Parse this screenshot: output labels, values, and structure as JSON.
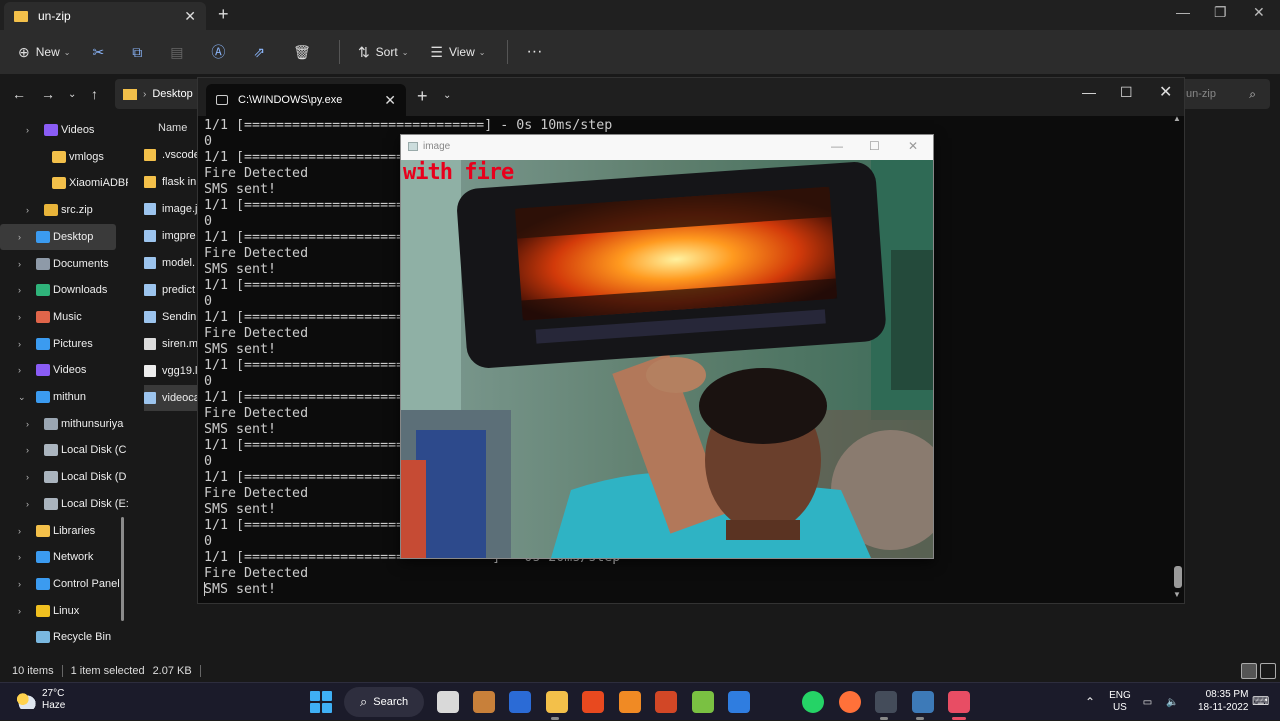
{
  "explorer": {
    "tab_title": "un-zip",
    "new_tab": "+",
    "close": "✕",
    "toolbar": {
      "new_label": "New",
      "sort_label": "Sort",
      "view_label": "View",
      "more": "···"
    },
    "address_crumb": "Desktop",
    "search_placeholder": "un-zip",
    "column_header": "Name",
    "nav": [
      {
        "label": "Videos",
        "color": "#8a5cf5",
        "chev": ">"
      },
      {
        "label": "vmlogs",
        "color": "#f3c04a",
        "chev": ""
      },
      {
        "label": "XiaomiADBFa",
        "color": "#f3c04a",
        "chev": ""
      },
      {
        "label": "src.zip",
        "color": "#e8b43a",
        "chev": ">"
      },
      {
        "label": "Desktop",
        "color": "#3b9bf0",
        "chev": ">"
      },
      {
        "label": "Documents",
        "color": "#8e9aa8",
        "chev": ">"
      },
      {
        "label": "Downloads",
        "color": "#2fb37a",
        "chev": ">"
      },
      {
        "label": "Music",
        "color": "#e0654a",
        "chev": ">"
      },
      {
        "label": "Pictures",
        "color": "#3b9bf0",
        "chev": ">"
      },
      {
        "label": "Videos",
        "color": "#8a5cf5",
        "chev": ">"
      },
      {
        "label": "mithun",
        "color": "#3b9bf0",
        "chev": "v"
      },
      {
        "label": "mithunsuriya",
        "color": "#9aa6b2",
        "chev": ">"
      },
      {
        "label": "Local Disk (C",
        "color": "#aab4be",
        "chev": ">"
      },
      {
        "label": "Local Disk (D",
        "color": "#aab4be",
        "chev": ">"
      },
      {
        "label": "Local Disk (E:",
        "color": "#aab4be",
        "chev": ">"
      },
      {
        "label": "Libraries",
        "color": "#f3c04a",
        "chev": ">"
      },
      {
        "label": "Network",
        "color": "#3b9bf0",
        "chev": ">"
      },
      {
        "label": "Control Panel",
        "color": "#3b9bf0",
        "chev": ">"
      },
      {
        "label": "Linux",
        "color": "#f0c020",
        "chev": ">"
      },
      {
        "label": "Recycle Bin",
        "color": "#7ab8e0",
        "chev": ""
      }
    ],
    "files": [
      {
        "name": ".vscode",
        "color": "#f3c04a"
      },
      {
        "name": "flask in",
        "color": "#f3c04a"
      },
      {
        "name": "image.j",
        "color": "#9cc4ee"
      },
      {
        "name": "imgpre",
        "color": "#9cc4ee"
      },
      {
        "name": "model.",
        "color": "#9cc4ee"
      },
      {
        "name": "predict",
        "color": "#9cc4ee"
      },
      {
        "name": "Sendin",
        "color": "#9cc4ee"
      },
      {
        "name": "siren.m",
        "color": "#dddddd"
      },
      {
        "name": "vgg19.l",
        "color": "#eeeeee"
      },
      {
        "name": "videoca",
        "color": "#9cc4ee"
      }
    ],
    "status": {
      "count": "10 items",
      "selected": "1 item selected",
      "size": "2.07 KB"
    }
  },
  "terminal": {
    "tab_title": "C:\\WINDOWS\\py.exe",
    "new_tab": "+",
    "dropdown": "⌄",
    "close": "✕",
    "lines": [
      "1/1 [==============================] - 0s 10ms/step",
      "0",
      "1/1 [=====================",
      "Fire Detected",
      "SMS sent!",
      "1/1 [=====================",
      "0",
      "1/1 [=====================",
      "Fire Detected",
      "SMS sent!",
      "1/1 [=====================",
      "0",
      "1/1 [=====================",
      "Fire Detected",
      "SMS sent!",
      "1/1 [=====================",
      "0",
      "1/1 [=====================",
      "Fire Detected",
      "SMS sent!",
      "1/1 [=====================",
      "0",
      "1/1 [=====================",
      "Fire Detected",
      "SMS sent!",
      "1/1 [=====================",
      "0",
      "1/1 [=====================          ] - 0s 20ms/step",
      "Fire Detected",
      "SMS sent!"
    ]
  },
  "image_window": {
    "title": "image",
    "caption": "with fire",
    "min": "—",
    "max": "☐",
    "close": "✕"
  },
  "taskbar": {
    "temp": "27°C",
    "weather": "Haze",
    "search_label": "Search",
    "lang_top": "ENG",
    "lang_bottom": "US",
    "time": "08:35 PM",
    "date": "18-11-2022",
    "apps": [
      {
        "name": "task-view",
        "color": "#d9d9d9"
      },
      {
        "name": "photos",
        "color": "#c8803a"
      },
      {
        "name": "word",
        "color": "#2b6bd6"
      },
      {
        "name": "file-explorer",
        "color": "#f3c04a"
      },
      {
        "name": "office",
        "color": "#e8491f"
      },
      {
        "name": "sublime-text",
        "color": "#f08a24"
      },
      {
        "name": "powerpoint",
        "color": "#d24726"
      },
      {
        "name": "notepad-green",
        "color": "#7ac142"
      },
      {
        "name": "azure-vscode",
        "color": "#2f7de0"
      },
      {
        "name": "whatsapp",
        "color": "#25d366"
      },
      {
        "name": "firefox",
        "color": "#ff7139"
      },
      {
        "name": "terminal",
        "color": "#444c5a"
      },
      {
        "name": "python",
        "color": "#3d7ab8"
      },
      {
        "name": "image-viewer",
        "color": "#e84d64"
      }
    ]
  }
}
